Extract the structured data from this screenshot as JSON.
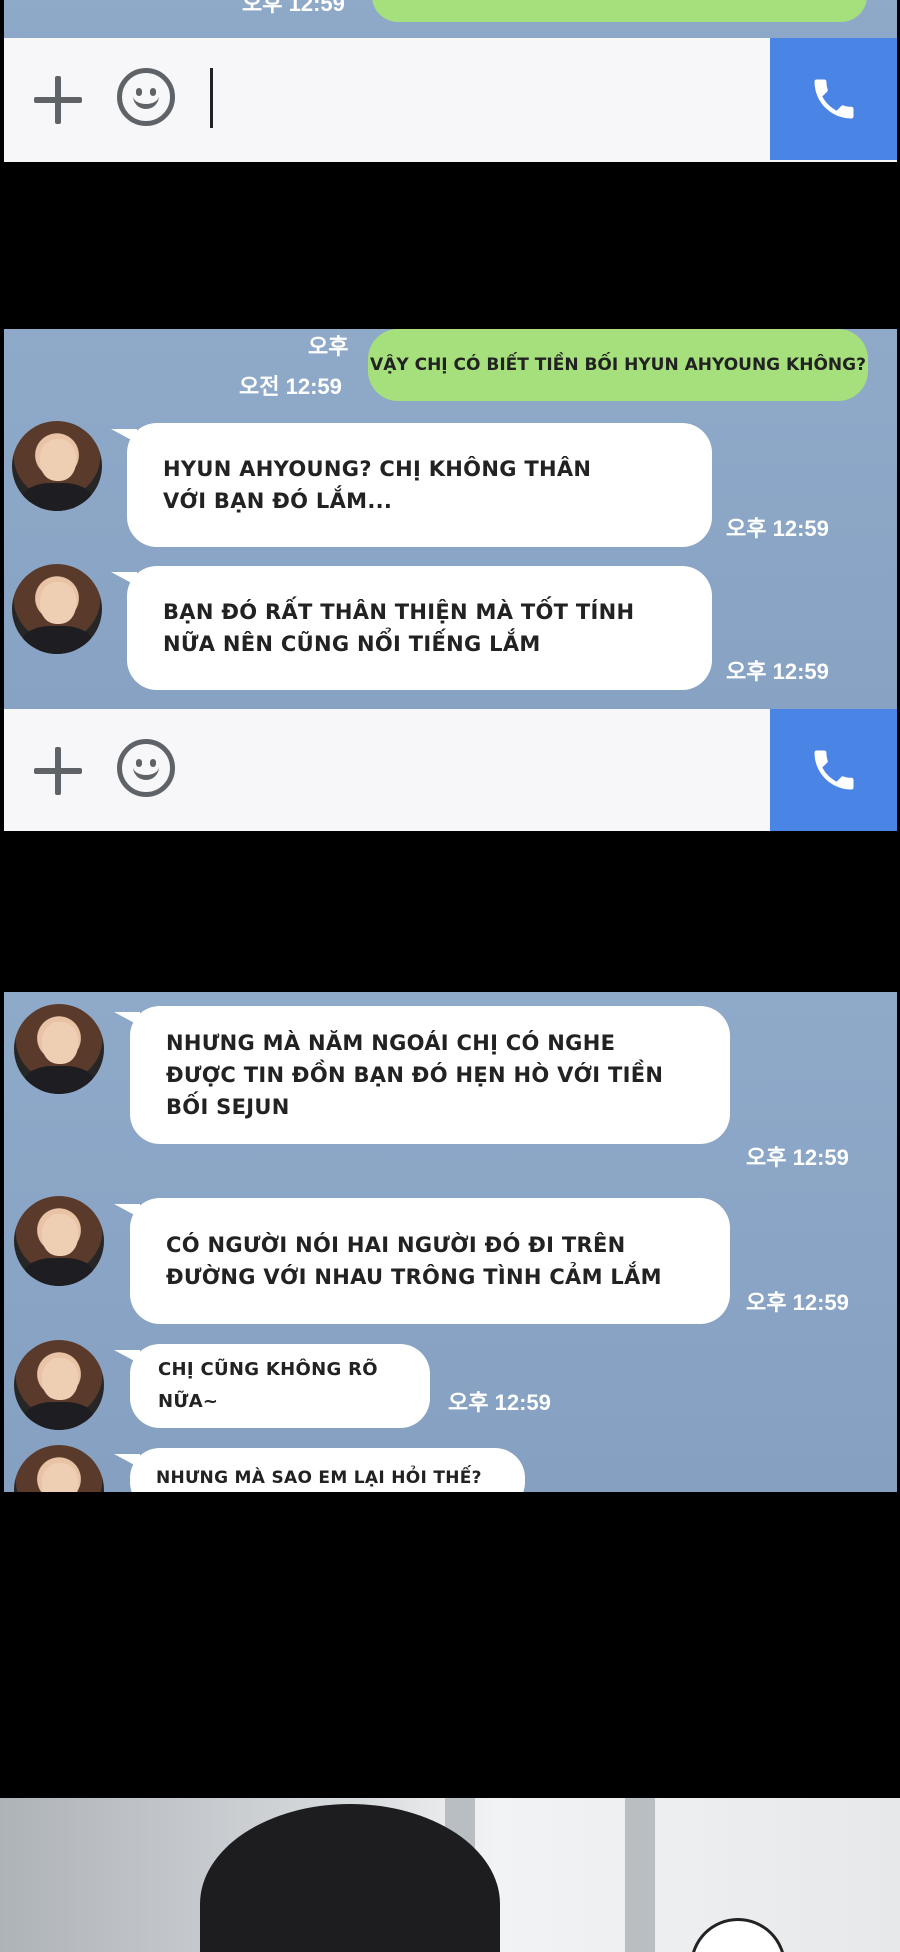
{
  "panel1": {
    "top_time": "오후 12:59"
  },
  "panel2": {
    "out_time_line1": "오후",
    "out_time_line2": "오전 12:59",
    "out_message": "VẬY CHỊ CÓ BIẾT TIỀN BỐI HYUN AHYOUNG KHÔNG?",
    "messages": [
      {
        "text": "HYUN AHYOUNG? CHỊ KHÔNG THÂN VỚI BẠN ĐÓ LẮM...",
        "time": "오후 12:59"
      },
      {
        "text": "BẠN ĐÓ RẤT THÂN THIỆN MÀ TỐT TÍNH NỮA NÊN CŨNG NỔI TIẾNG LẮM",
        "time": "오후 12:59"
      }
    ]
  },
  "panel3": {
    "messages": [
      {
        "text": "NHƯNG MÀ NĂM NGOÁI CHỊ CÓ NGHE ĐƯỢC TIN ĐỒN BẠN ĐÓ HẸN HÒ VỚI TIỀN BỐI SEJUN",
        "time": "오후 12:59"
      },
      {
        "text": "CÓ NGƯỜI NÓI HAI NGƯỜI ĐÓ ĐI TRÊN ĐƯỜNG VỚI NHAU TRÔNG TÌNH CẢM LẮM",
        "time": "오후 12:59"
      },
      {
        "text": "CHỊ CŨNG KHÔNG RÕ NỮA~",
        "time": "오후 12:59"
      },
      {
        "text": "NHƯNG MÀ SAO EM LẠI HỎI THẾ?"
      }
    ]
  },
  "icons": {
    "plus": "plus-icon",
    "emoji": "smiley-icon",
    "call": "phone-icon"
  },
  "colors": {
    "chat_bg": "#8ba5c6",
    "outgoing_bubble": "#a6e07c",
    "call_button": "#4a84e4"
  }
}
